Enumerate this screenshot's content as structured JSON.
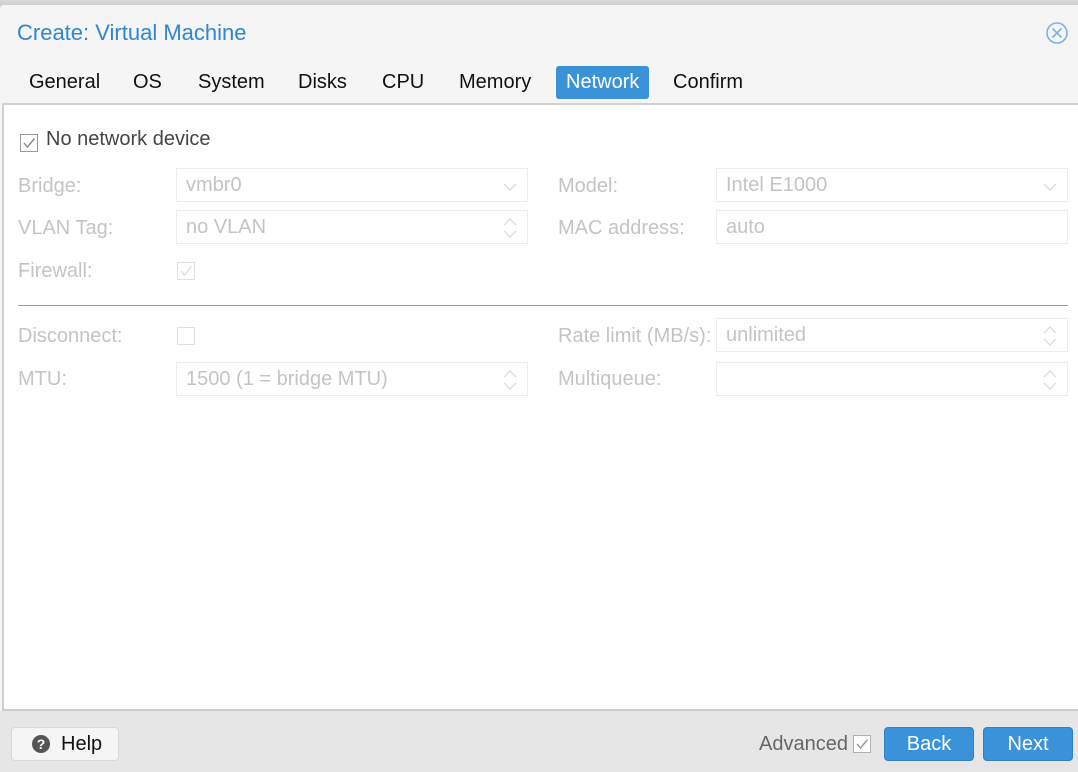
{
  "dialog": {
    "title": "Create: Virtual Machine",
    "close_icon": "close-circle-icon"
  },
  "tabs": [
    {
      "label": "General",
      "active": false
    },
    {
      "label": "OS",
      "active": false
    },
    {
      "label": "System",
      "active": false
    },
    {
      "label": "Disks",
      "active": false
    },
    {
      "label": "CPU",
      "active": false
    },
    {
      "label": "Memory",
      "active": false
    },
    {
      "label": "Network",
      "active": true
    },
    {
      "label": "Confirm",
      "active": false
    }
  ],
  "form": {
    "no_network_device": {
      "label": "No network device",
      "checked": true
    },
    "bridge": {
      "label": "Bridge:",
      "value": "vmbr0",
      "disabled": true
    },
    "vlan_tag": {
      "label": "VLAN Tag:",
      "value": "no VLAN",
      "disabled": true
    },
    "firewall": {
      "label": "Firewall:",
      "checked": true,
      "disabled": true
    },
    "model": {
      "label": "Model:",
      "value": "Intel E1000",
      "disabled": true
    },
    "mac_address": {
      "label": "MAC address:",
      "value": "auto",
      "disabled": true
    },
    "disconnect": {
      "label": "Disconnect:",
      "checked": false,
      "disabled": true
    },
    "mtu": {
      "label": "MTU:",
      "value": "1500 (1 = bridge MTU)",
      "disabled": true
    },
    "rate_limit": {
      "label": "Rate limit (MB/s):",
      "value": "unlimited",
      "disabled": true
    },
    "multiqueue": {
      "label": "Multiqueue:",
      "value": "",
      "disabled": true
    }
  },
  "footer": {
    "help_label": "Help",
    "advanced_label": "Advanced",
    "advanced_checked": true,
    "back_label": "Back",
    "next_label": "Next"
  },
  "colors": {
    "accent": "#3a92d8",
    "title": "#2f86d3",
    "disabled_text": "#c4c4c4"
  }
}
